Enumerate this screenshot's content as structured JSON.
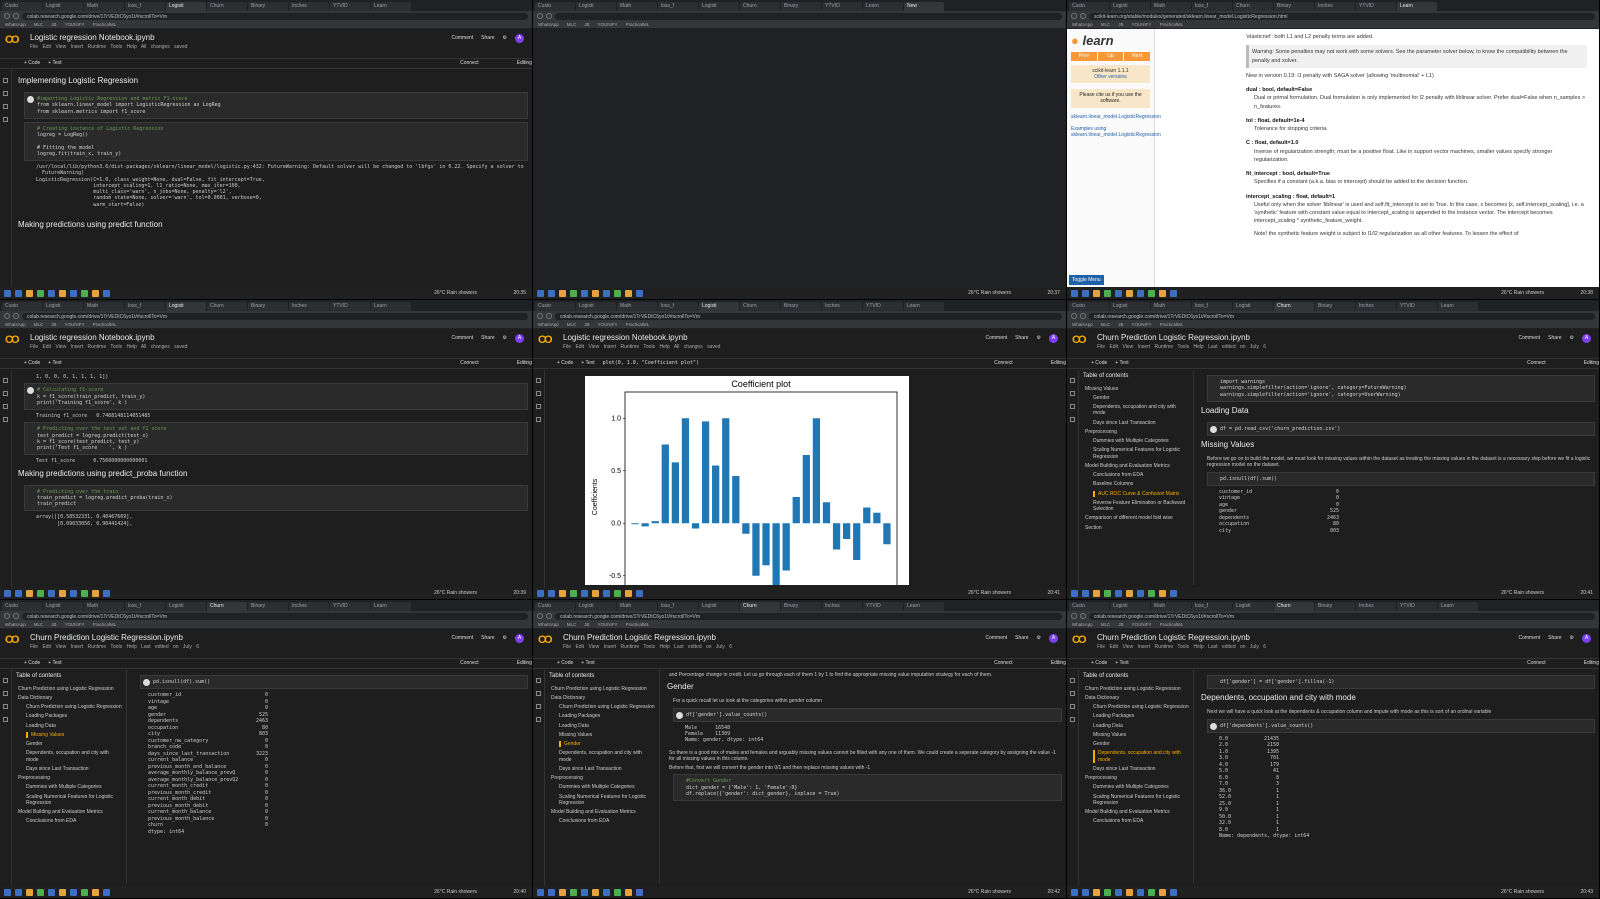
{
  "tabs": [
    "Custo",
    "Logisti",
    "Math",
    "loss_f",
    "Logisti",
    "Churn",
    "Binary",
    "Inches",
    "YTVID",
    "Learn",
    "Linear",
    "Logisti",
    "Churn",
    "Math"
  ],
  "bookmarks": [
    "WhatsApp",
    "MLC",
    "JB",
    "YOUNIFY",
    "PracticalML",
    "..."
  ],
  "colab_url": "colab.research.google.com/drive/1TrVEDtC6yo1t/#scrollTo=Vm",
  "sklearn_url": "scikit-learn.org/stable/modules/generated/sklearn.linear_model.LogisticRegression.html",
  "logistic_nb": {
    "title": "Logistic regression Notebook.ipynb",
    "menu": "File Edit View Insert Runtime Tools Help All changes saved"
  },
  "churn_nb": {
    "title": "Churn Prediction Logistic Regression.ipynb",
    "menu": "File Edit View Insert Runtime Tools Help Last edited on July 6"
  },
  "header_buttons": {
    "comment": "Comment",
    "share": "Share",
    "avatar": "A"
  },
  "toolbar": {
    "code": "+ Code",
    "text": "+ Text",
    "connect": "Connect",
    "editing": "Editing"
  },
  "pane1": {
    "section": "Implementing Logistic Regression",
    "cell1_c": "#importing Logistic Regression and metric F1-score",
    "cell1": "from sklearn.linear_model import LogisticRegression as LogReg\nfrom sklearn.metrics import f1_score",
    "cell2_c": "# Creating instance of Logistic Regression",
    "cell2": "logreg = LogReg()\n\n# Fitting the model\nlogreg.fit(train_x, train_y)",
    "out": "/usr/local/lib/python3.6/dist-packages/sklearn/linear_model/logistic.py:432: FutureWarning: Default solver will be changed to 'lbfgs' in 0.22. Specify a solver to\n  FutureWarning)\nLogisticRegression(C=1.0, class_weight=None, dual=False, fit_intercept=True,\n                   intercept_scaling=1, l1_ratio=None, max_iter=100,\n                   multi_class='warn', n_jobs=None, penalty='l2',\n                   random_state=None, solver='warn', tol=0.0001, verbose=0,\n                   warm_start=False)",
    "section2": "Making predictions using predict function"
  },
  "pane3": {
    "new_in": "New in version 0.19: l1 penalty with SAGA solver (allowing 'multinomial' + L1)",
    "elasticnet": "'elasticnet': both L1 and L2 penalty terms are added.",
    "warning": "Warning: Some penalties may not work with some solvers. See the parameter solver below, to know the compatibility between the penalty and solver.",
    "dual_h": "dual : bool, default=False",
    "dual_d": "Dual or primal formulation. Dual formulation is only implemented for l2 penalty with liblinear solver. Prefer dual=False when n_samples > n_features.",
    "tol_h": "tol : float, default=1e-4",
    "tol_d": "Tolerance for stopping criteria.",
    "c_h": "C : float, default=1.0",
    "c_d": "Inverse of regularization strength; must be a positive float. Like in support vector machines, smaller values specify stronger regularization.",
    "fit_h": "fit_intercept : bool, default=True",
    "fit_d": "Specifies if a constant (a.k.a. bias or intercept) should be added to the decision function.",
    "is_h": "intercept_scaling : float, default=1",
    "is_d": "Useful only when the solver 'liblinear' is used and self.fit_intercept is set to True. In this case, x becomes [x, self.intercept_scaling], i.e. a 'synthetic' feature with constant value equal to intercept_scaling is appended to the instance vector. The intercept becomes intercept_scaling * synthetic_feature_weight.",
    "note": "Note! the synthetic feature weight is subject to l1/l2 regularization as all other features. To lessen the effect of",
    "version": "scikit-learn 1.1.1",
    "other_versions": "Other versions",
    "cite": "Please cite us if you use the software.",
    "link1": "sklearn.linear_model.LogisticRegression",
    "link2": "Examples using sklearn.linear_model.LogisticRegression",
    "toggle": "Toggle Menu",
    "logo": "learn",
    "prev": "Prev",
    "up": "Up",
    "next": "Next"
  },
  "pane4": {
    "top_out": "1, 0, 0, 0, 1, 1, 1, 1])",
    "cell1_c": "# Calculating f1-score",
    "cell1": "k = f1_score(train_predict, train_y)\nprint('Training f1_score', k )",
    "out1": "Training f1_score   0.7468148114051485",
    "cell2_c": "# Predicting over the test set and f1 score",
    "cell2": "test_predict = logreg.predict(test_x)\nk = f1_score(test_predict, test_y)\nprint('Test f1_score    ', k )",
    "out2": "Test f1_score      0.7560000000000001",
    "section": "Making predictions using predict_proba function",
    "cell3_c": "# Predicting over the train",
    "cell3": "train_predict = logreg.predict_proba(train_x)\ntrain_predict",
    "out3": "array([[0.58532331, 0.40467669],\n       [0.09033056, 0.90441424],"
  },
  "pane5": {
    "code_line": "plot(0, 1.0, \"Coefficient plot\")",
    "chart_data": {
      "type": "bar",
      "title": "Coefficient plot",
      "ylabel": "Coefficients",
      "xlabel": "",
      "ylim": [
        -0.75,
        1.25
      ],
      "yticks": [
        -0.5,
        0.0,
        0.5,
        1.0
      ],
      "values": [
        0.0,
        -0.03,
        0.02,
        0.75,
        0.58,
        1.0,
        -0.05,
        0.97,
        0.55,
        1.0,
        0.45,
        -0.1,
        -0.5,
        -0.4,
        -0.65,
        -0.45,
        0.25,
        0.65,
        1.0,
        0.2,
        -0.25,
        -0.15,
        -0.35,
        0.15,
        0.1,
        -0.2
      ]
    }
  },
  "toc": {
    "header": "Table of contents",
    "items": [
      "Churn Prediction using Logistic Regression",
      "Data Dictionary",
      "Churn Prediction using Logistic Regression",
      "Loading Packages",
      "Loading Data",
      "Missing Values",
      "Gender",
      "Dependents, occupation and city with mode",
      "Days since Last Transaction",
      "Preprocessing",
      "Dummies with Multiple Categories",
      "Scaling Numerical Features for Logistic Regression",
      "Model Building and Evaluation Metrics",
      "Conclusions from EDA"
    ]
  },
  "toc6": {
    "items": [
      "Missing Values",
      "Gender",
      "Dependents, occupation and city with mode",
      "Days since Last Transaction",
      "Preprocessing",
      "Dummies with Multiple Categories",
      "Scaling Numerical Features for Logistic Regression",
      "Model Building and Evaluation Metrics",
      "Conclusions from EDA",
      "Baseline Columns",
      "AUC ROC Curve & Confusion Matrix",
      "Reverse Feature Elimination or Backward Selection",
      "Comparison of different model fold wise",
      "Section"
    ]
  },
  "pane6": {
    "cell0": "import warnings\nwarnings.simplefilter(action='ignore', category=FutureWarning)\nwarnings.simplefilter(action='ignore', category=UserWarning)",
    "loading": "Loading Data",
    "cell1": "df = pd.read_csv('churn_prediction.csv')",
    "missing": "Missing Values",
    "missing_desc": "Before we go on to build the model, we must look for missing values within the dataset as treating the missing values in the dataset is a necessary step before we fit a logistic regression model on the dataset.",
    "cell2": "pd.isnull(df).sum()",
    "rows": [
      [
        "customer_id",
        "0"
      ],
      [
        "vintage",
        "0"
      ],
      [
        "age",
        "0"
      ],
      [
        "gender",
        "525"
      ],
      [
        "dependents",
        "2463"
      ],
      [
        "occupation",
        "80"
      ],
      [
        "city",
        "803"
      ]
    ]
  },
  "pane7": {
    "cell": "pd.isnull(df).sum()",
    "rows": [
      [
        "customer_id",
        "0"
      ],
      [
        "vintage",
        "0"
      ],
      [
        "age",
        "0"
      ],
      [
        "gender",
        "525"
      ],
      [
        "dependents",
        "2463"
      ],
      [
        "occupation",
        "80"
      ],
      [
        "city",
        "803"
      ],
      [
        "customer_nw_category",
        "0"
      ],
      [
        "branch_code",
        "0"
      ],
      [
        "days_since_last_transaction",
        "3223"
      ],
      [
        "current_balance",
        "0"
      ],
      [
        "previous_month_end_balance",
        "0"
      ],
      [
        "average_monthly_balance_prevQ",
        "0"
      ],
      [
        "average_monthly_balance_prevQ2",
        "0"
      ],
      [
        "current_month_credit",
        "0"
      ],
      [
        "previous_month_credit",
        "0"
      ],
      [
        "current_month_debit",
        "0"
      ],
      [
        "previous_month_debit",
        "0"
      ],
      [
        "current_month_balance",
        "0"
      ],
      [
        "previous_month_balance",
        "0"
      ],
      [
        "churn",
        "0"
      ],
      [
        "dtype: int64",
        ""
      ]
    ]
  },
  "pane8": {
    "intro": "and Percentage change in credit. Let us go through each of them 1 by 1 to find the appropriate missing value imputation strategy for each of them.",
    "gender": "Gender",
    "recall": "For a quick recall let us look at the categories within gender column",
    "cell1": "df['gender'].value_counts()",
    "out1": "Male      16548\nFemale    11309\nName: gender, dtype: int64",
    "desc2": "So there is a good mix of males and females and arguably missing values cannot be filled with any one of them. We could create a seperate category by assigning the value -1 for all missing values in this column.",
    "desc3": "Before that, first we will convert the gender into 0/1 and then replace missing values with -1",
    "cell2_c": "#Convert Gender",
    "cell2": "dict_gender = {'Male': 1, 'Female':0}\ndf.replace({'gender': dict_gender}, inplace = True)"
  },
  "pane9": {
    "top": "df['gender'] = df['gender'].fillna(-1)",
    "section": "Dependents, occupation and city with mode",
    "desc": "Next we will have a quick look at the dependents & occupation column and impute with mode as this is sort of an ordinal variable",
    "cell": "df['dependents'].value_counts()",
    "rows": [
      [
        "0.0",
        "21435"
      ],
      [
        "2.0",
        "2150"
      ],
      [
        "1.0",
        "1395"
      ],
      [
        "3.0",
        "701"
      ],
      [
        "4.0",
        "179"
      ],
      [
        "5.0",
        "41"
      ],
      [
        "6.0",
        "8"
      ],
      [
        "7.0",
        "3"
      ],
      [
        "36.0",
        "1"
      ],
      [
        "52.0",
        "1"
      ],
      [
        "25.0",
        "1"
      ],
      [
        "9.0",
        "1"
      ],
      [
        "50.0",
        "1"
      ],
      [
        "32.0",
        "1"
      ],
      [
        "8.0",
        "1"
      ]
    ],
    "dtype": "Name: dependents, dtype: int64"
  },
  "taskbar": {
    "weather": "26°C  Rain showers",
    "lang": "ENG"
  },
  "clocks": [
    "20:35",
    "20:37",
    "20:38",
    "20:39",
    "20:41",
    "20:41",
    "20:40",
    "20:42",
    "20:43"
  ]
}
